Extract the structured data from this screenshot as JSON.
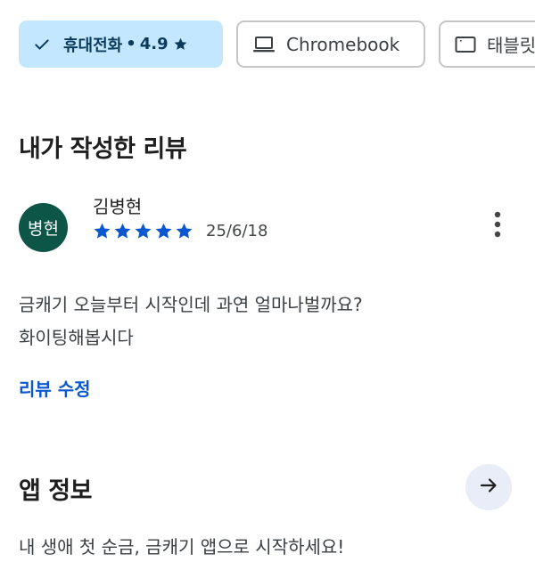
{
  "chips": {
    "phone": {
      "label": "휴대전화",
      "separator": "•",
      "rating": "4.9",
      "icon": "check-icon"
    },
    "chromebook": {
      "label": "Chromebook",
      "icon": "laptop-icon"
    },
    "tablet": {
      "label": "태블릿",
      "icon": "tablet-icon"
    }
  },
  "my_review": {
    "title": "내가 작성한 리뷰",
    "reviewer": {
      "avatar_text": "병현",
      "avatar_color": "#0d5546",
      "name": "김병현"
    },
    "rating": 5,
    "date": "25/6/18",
    "text_lines": [
      "금캐기 오늘부터 시작인데 과연 얼마나벌까요?",
      "화이팅해봅시다"
    ],
    "edit_label": "리뷰 수정",
    "more_icon": "more-vert-icon"
  },
  "app_info": {
    "title": "앱 정보",
    "description": "내 생애 첫 순금, 금캐기 앱으로 시작하세요!",
    "arrow_icon": "arrow-right-icon"
  },
  "colors": {
    "accent": "#0b57d0",
    "chip_selected_bg": "#c2e7ff",
    "star": "#0b57d0"
  }
}
